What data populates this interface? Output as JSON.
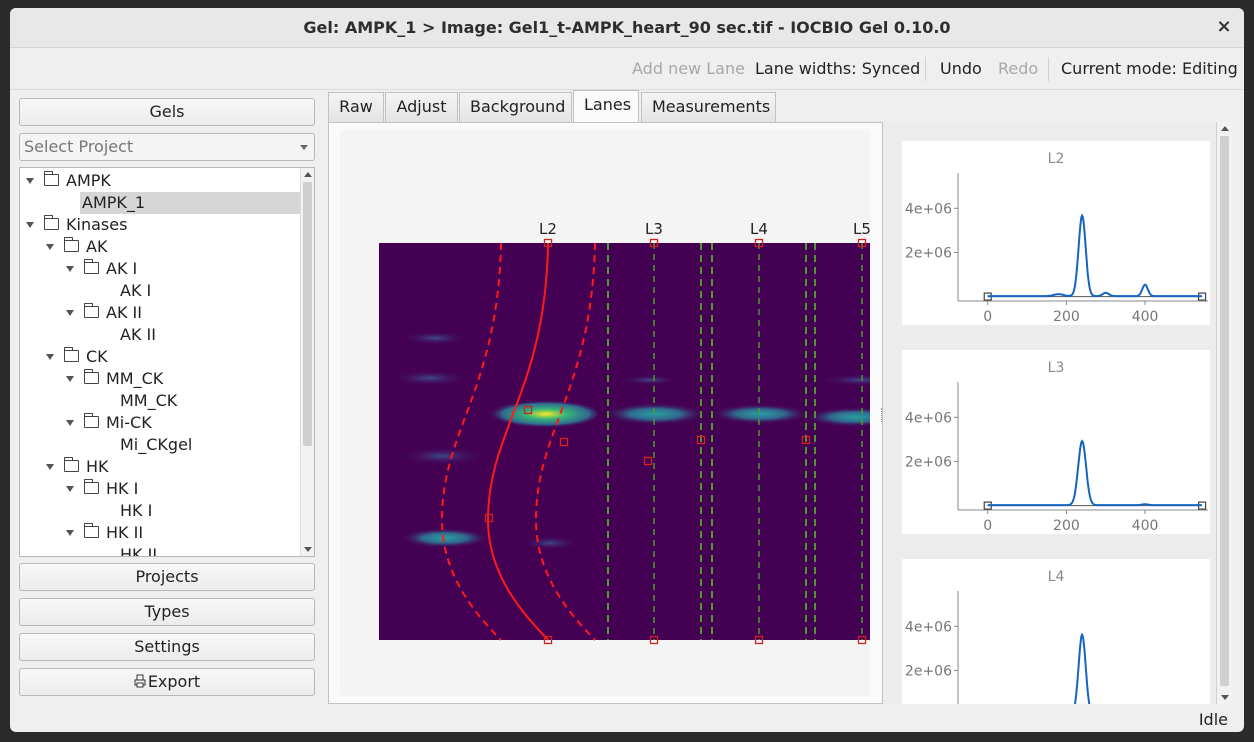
{
  "window": {
    "title": "Gel: AMPK_1 > Image: Gel1_t-AMPK_heart_90 sec.tif - IOCBIO Gel 0.10.0",
    "close_glyph": "×"
  },
  "toolbar": {
    "add_lane": "Add new Lane",
    "lane_widths": "Lane widths: Synced",
    "undo": "Undo",
    "redo": "Redo",
    "mode": "Current mode: Editing"
  },
  "sidebar": {
    "gels_button": "Gels",
    "project_select_placeholder": "Select Project",
    "tree": [
      {
        "label": "AMPK",
        "depth": 0,
        "folder": true,
        "expanded": true
      },
      {
        "label": "AMPK_1",
        "depth": 1,
        "folder": false,
        "selected": true
      },
      {
        "label": "Kinases",
        "depth": 0,
        "folder": true,
        "expanded": true
      },
      {
        "label": "AK",
        "depth": 1,
        "folder": true,
        "expanded": true
      },
      {
        "label": "AK I",
        "depth": 2,
        "folder": true,
        "expanded": true
      },
      {
        "label": "AK I",
        "depth": 3,
        "folder": false
      },
      {
        "label": "AK II",
        "depth": 2,
        "folder": true,
        "expanded": true
      },
      {
        "label": "AK II",
        "depth": 3,
        "folder": false
      },
      {
        "label": "CK",
        "depth": 1,
        "folder": true,
        "expanded": true
      },
      {
        "label": "MM_CK",
        "depth": 2,
        "folder": true,
        "expanded": true
      },
      {
        "label": "MM_CK",
        "depth": 3,
        "folder": false
      },
      {
        "label": "Mi-CK",
        "depth": 2,
        "folder": true,
        "expanded": true
      },
      {
        "label": "Mi_CKgel",
        "depth": 3,
        "folder": false
      },
      {
        "label": "HK",
        "depth": 1,
        "folder": true,
        "expanded": true
      },
      {
        "label": "HK I",
        "depth": 2,
        "folder": true,
        "expanded": true
      },
      {
        "label": "HK I",
        "depth": 3,
        "folder": false
      },
      {
        "label": "HK II",
        "depth": 2,
        "folder": true,
        "expanded": true
      },
      {
        "label": "HK II",
        "depth": 3,
        "folder": false
      }
    ],
    "projects_button": "Projects",
    "types_button": "Types",
    "settings_button": "Settings",
    "export_button": "Export",
    "export_icon": "printer-icon"
  },
  "tabs": [
    {
      "label": "Raw",
      "active": false
    },
    {
      "label": "Adjust",
      "active": false
    },
    {
      "label": "Background",
      "active": false
    },
    {
      "label": "Lanes",
      "active": true
    },
    {
      "label": "Measurements",
      "active": false
    }
  ],
  "gel": {
    "lanes": [
      "L2",
      "L3",
      "L4",
      "L5"
    ],
    "colors": {
      "background": "#440154",
      "active_lane": "#ff1a1a",
      "inactive_lane": "#4d9a2a",
      "lane_handle": "#d42020",
      "band_peak": "#fde725",
      "band_mid": "#35b779",
      "band_low": "#31688e"
    }
  },
  "profiles": [
    {
      "title": "L2",
      "chart_data": {
        "type": "line",
        "title": "L2",
        "xlabel": "",
        "ylabel": "",
        "xlim": [
          -40,
          560
        ],
        "ylim": [
          -200000,
          5600000
        ],
        "x_ticks": [
          "0",
          "200",
          "400"
        ],
        "y_ticks": [
          "2e+06",
          "4e+06"
        ],
        "series_color": "#1565c0",
        "baseline_color": "#555555",
        "peaks": [
          {
            "x": 240,
            "height": 3650000,
            "width": 9
          },
          {
            "x": 180,
            "height": 90000,
            "width": 12
          },
          {
            "x": 300,
            "height": 150000,
            "width": 8
          },
          {
            "x": 400,
            "height": 520000,
            "width": 7
          }
        ],
        "baseline": [
          [
            0,
            0
          ],
          [
            545,
            0
          ]
        ]
      }
    },
    {
      "title": "L3",
      "chart_data": {
        "type": "line",
        "title": "L3",
        "xlabel": "",
        "ylabel": "",
        "xlim": [
          -40,
          560
        ],
        "ylim": [
          -200000,
          5600000
        ],
        "x_ticks": [
          "0",
          "200",
          "400"
        ],
        "y_ticks": [
          "2e+06",
          "4e+06"
        ],
        "series_color": "#1565c0",
        "baseline_color": "#555555",
        "peaks": [
          {
            "x": 240,
            "height": 2900000,
            "width": 10
          },
          {
            "x": 400,
            "height": 40000,
            "width": 8
          }
        ],
        "baseline": [
          [
            0,
            0
          ],
          [
            545,
            0
          ]
        ]
      }
    },
    {
      "title": "L4",
      "chart_data": {
        "type": "line",
        "title": "L4",
        "xlabel": "",
        "ylabel": "",
        "xlim": [
          -40,
          560
        ],
        "ylim": [
          -200000,
          5600000
        ],
        "x_ticks": [],
        "y_ticks": [
          "2e+06",
          "4e+06"
        ],
        "series_color": "#1565c0",
        "baseline_color": "#555555",
        "peaks": [
          {
            "x": 240,
            "height": 3600000,
            "width": 9
          }
        ],
        "baseline": []
      }
    }
  ],
  "status": "Idle"
}
